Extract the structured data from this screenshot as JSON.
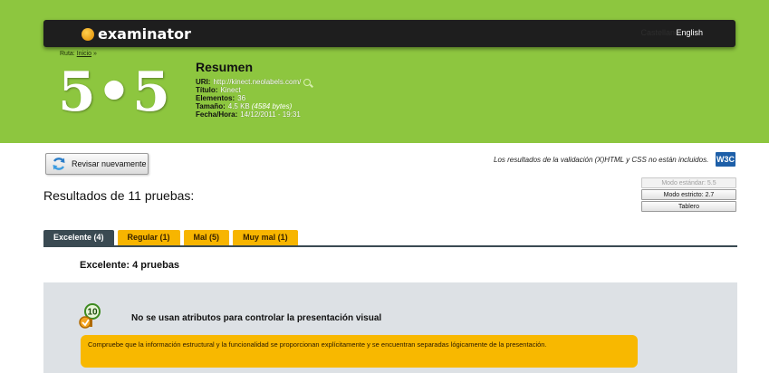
{
  "header": {
    "brand": "examinator",
    "language_link": "English",
    "language_hidden": "Castellano",
    "breadcrumb_prefix": "Ruta:",
    "breadcrumb_home": "Inicio",
    "breadcrumb_sep": "»"
  },
  "score": "5•5",
  "summary": {
    "heading": "Resumen",
    "uri_label": "URI:",
    "uri_value": "http://kinect.neolabels.com/",
    "title_label": "Título:",
    "title_value": "Kinect",
    "elements_label": "Elementos:",
    "elements_value": "36",
    "size_label": "Tamaño:",
    "size_value": "4.5 KB",
    "size_bytes": "(4584 bytes)",
    "datetime_label": "Fecha/Hora:",
    "datetime_value": "14/12/2011 - 19:31"
  },
  "actions": {
    "recheck_label": "Revisar nuevamente",
    "validation_note": "Los resultados de la validación (X)HTML y CSS no están incluidos.",
    "w3c_badge": "W3C"
  },
  "modes": [
    {
      "label": "Modo estándar: 5.5",
      "disabled": true
    },
    {
      "label": "Modo estricto: 2.7",
      "disabled": false
    },
    {
      "label": "Tablero",
      "disabled": false
    }
  ],
  "results_title": "Resultados de 11 pruebas:",
  "tabs": [
    {
      "label": "Excelente (4)",
      "active": true
    },
    {
      "label": "Regular (1)",
      "active": false
    },
    {
      "label": "Mal (5)",
      "active": false
    },
    {
      "label": "Muy mal (1)",
      "active": false
    }
  ],
  "section_title": "Excelente: 4 pruebas",
  "test": {
    "score_badge": "10",
    "title": "No se usan atributos para controlar la presentación visual",
    "note": "Compruebe que la información estructural y la funcionalidad se proporcionan explícitamente y se encuentran separadas lógicamente de la presentación."
  },
  "colors": {
    "header_green": "#8dc63f",
    "topbar_dark": "#1e1e1e",
    "tab_active": "#3a4a52",
    "tab_orange": "#f7b500",
    "panel_gray": "#dde1e5",
    "note_orange": "#f8b800"
  }
}
